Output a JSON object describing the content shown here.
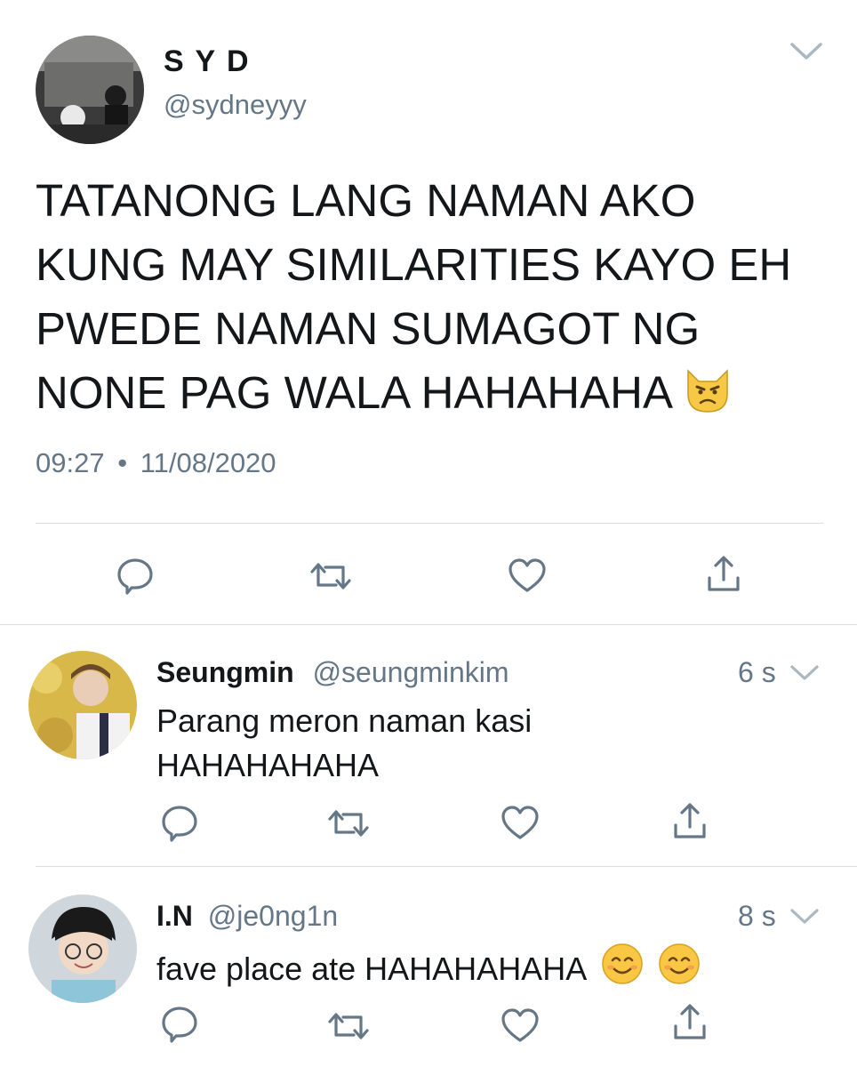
{
  "main_tweet": {
    "display_name": "S Y D",
    "handle": "@sydneyyy",
    "text": "TATANONG LANG NAMAN AKO KUNG MAY SIMILARITIES KAYO EH PWEDE NAMAN SUMAGOT NG NONE PAG WALA HAHAHAHA",
    "emoji": "smirking-angry-cat-emoji",
    "time": "09:27",
    "date": "11/08/2020",
    "separator": "•"
  },
  "replies": [
    {
      "display_name": "Seungmin",
      "handle": "@seungminkim",
      "time_ago": "6 s",
      "text_line1": "Parang meron naman kasi",
      "text_line2": "HAHAHAHAHA"
    },
    {
      "display_name": "I.N",
      "handle": "@je0ng1n",
      "time_ago": "8 s",
      "text": "fave place ate HAHAHAHAHA",
      "emojis": [
        "smiling-face-emoji",
        "smiling-face-emoji"
      ]
    }
  ],
  "colors": {
    "text": "#14171a",
    "muted": "#657786",
    "icon": "#657786",
    "divider": "#d9dde1",
    "background": "#ffffff"
  }
}
